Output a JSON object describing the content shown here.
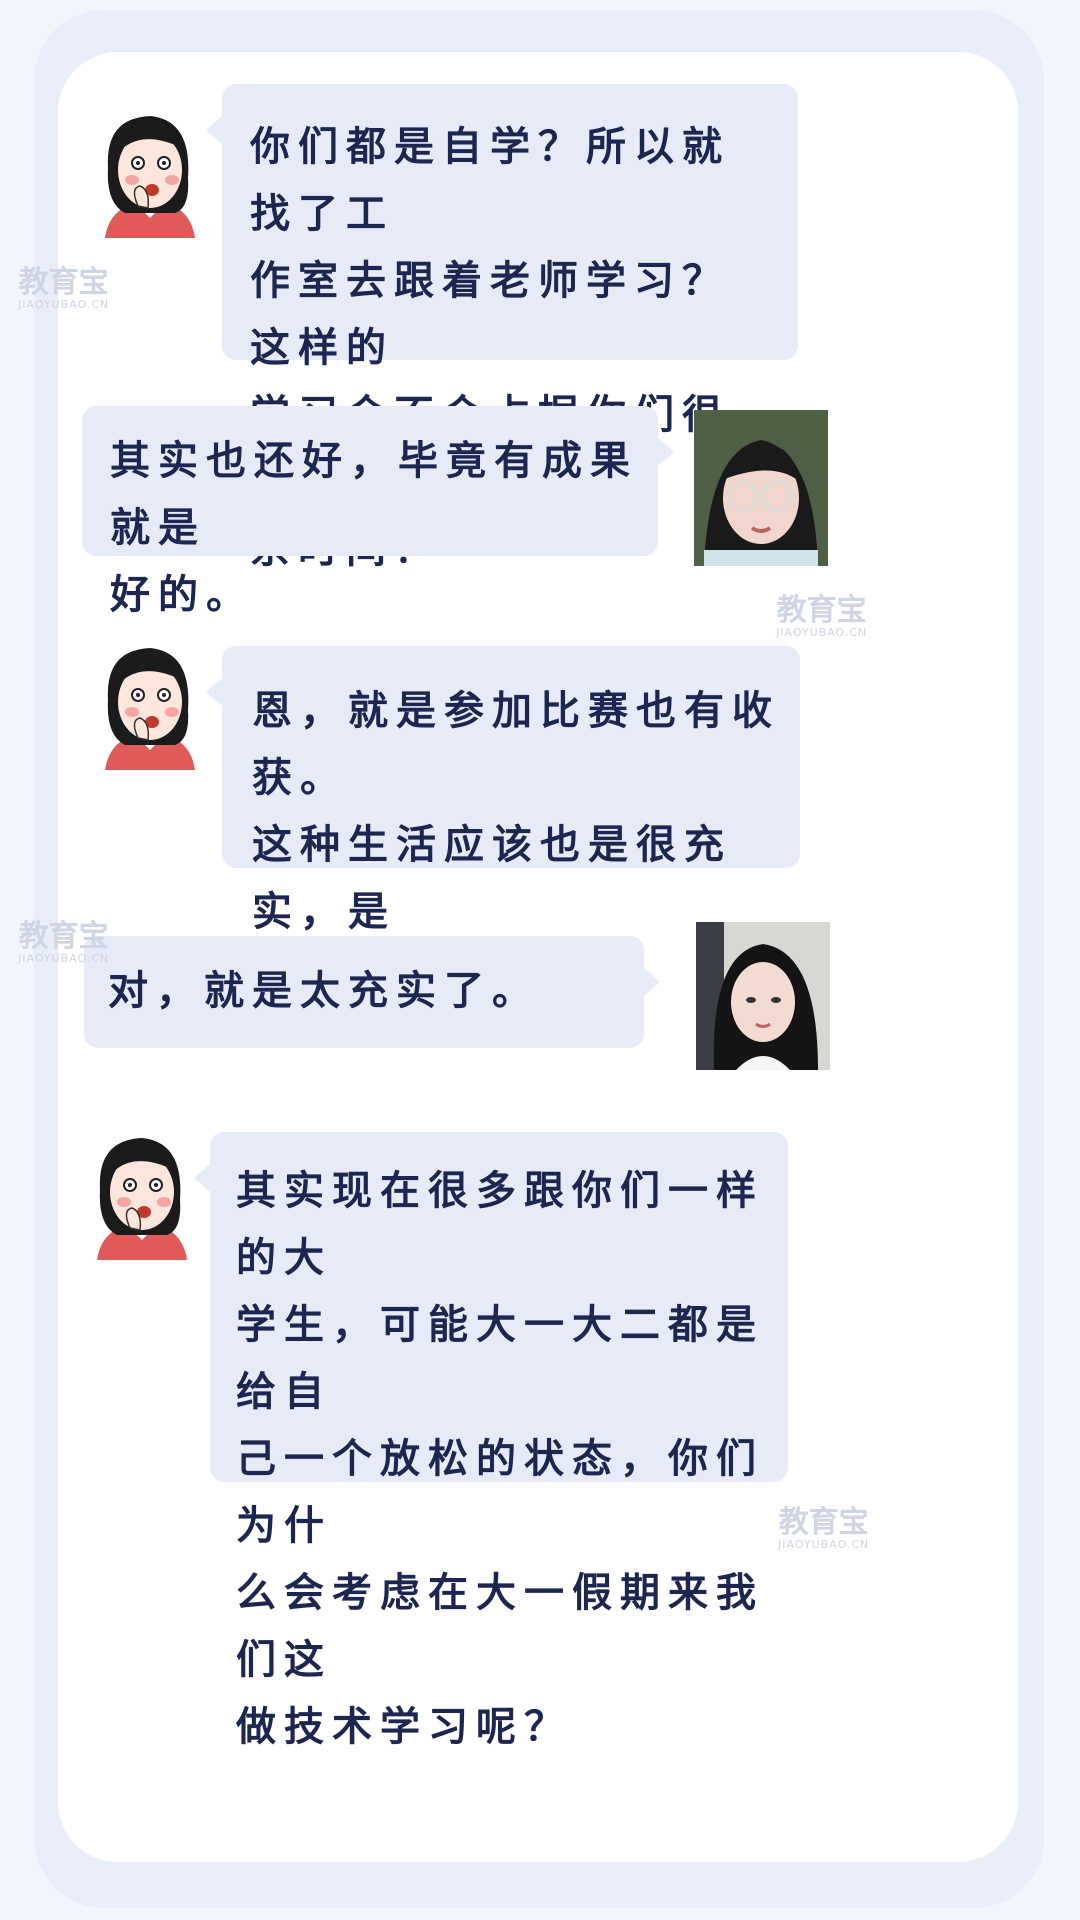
{
  "messages": [
    {
      "side": "left",
      "text": "你们都是自学？所以就找了工\n作室去跟着老师学习？这样的\n学习会不会占据你们很多的课\n余时间？"
    },
    {
      "side": "right",
      "text": "其实也还好，毕竟有成果就是\n好的。"
    },
    {
      "side": "left",
      "text": "恩，就是参加比赛也有收获。\n这种生活应该也是很充实，是\n不是？"
    },
    {
      "side": "right",
      "text": "对，就是太充实了。"
    },
    {
      "side": "left",
      "text": "其实现在很多跟你们一样的大\n学生，可能大一大二都是给自\n己一个放松的状态，你们为什\n么会考虑在大一假期来我们这\n做技术学习呢？"
    }
  ],
  "watermark": {
    "name": "教育宝",
    "domain": "JIAOYUBAO.CN"
  },
  "colors": {
    "bubble": "#e7ebf8",
    "text": "#1d2650",
    "frame": "#e9edfa"
  }
}
